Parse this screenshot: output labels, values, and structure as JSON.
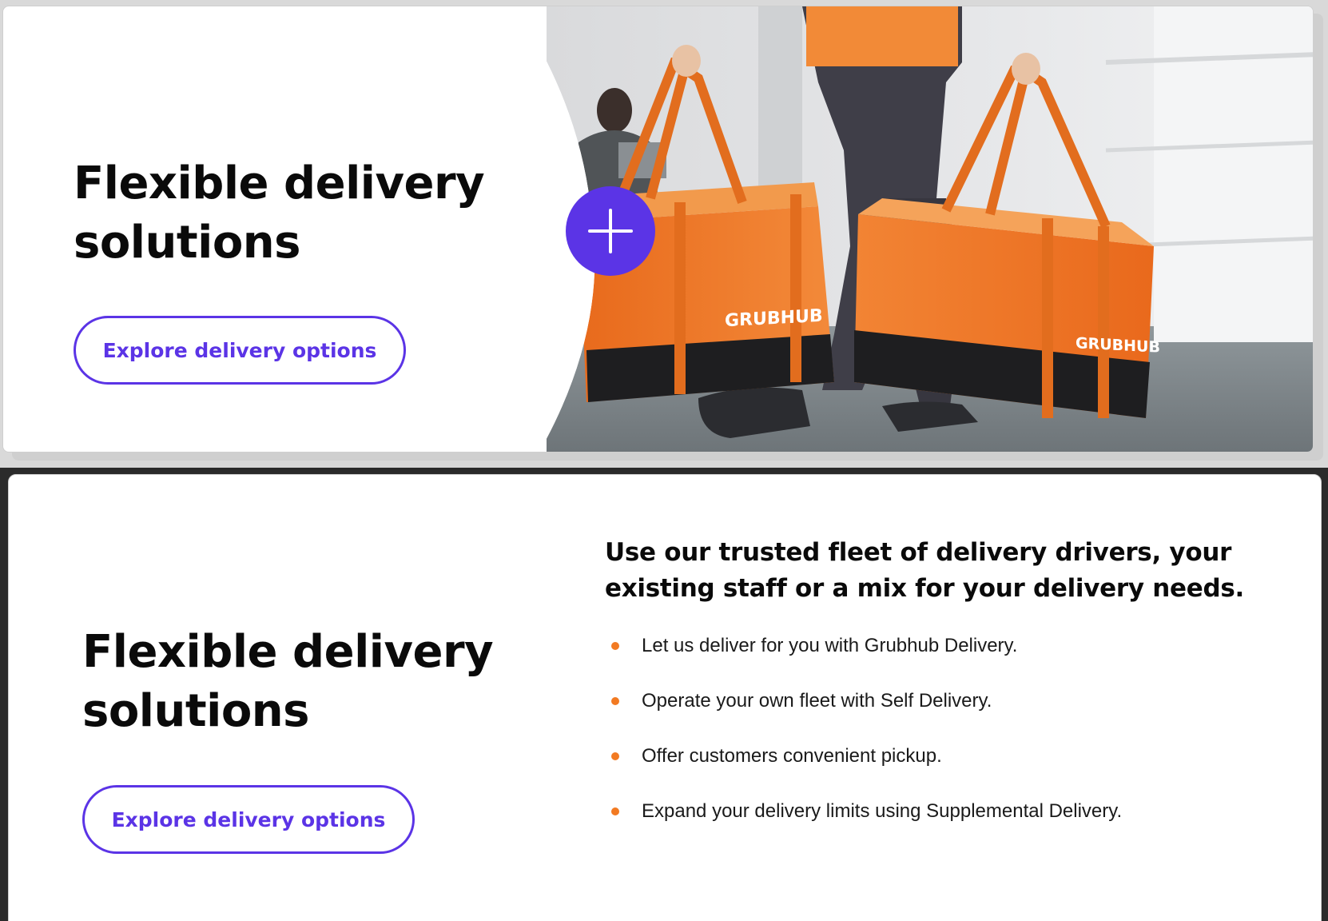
{
  "top_card": {
    "headline_line1": "Flexible delivery",
    "headline_line2": "solutions",
    "cta_label": "Explore delivery options",
    "bag_brand_left": "GRUBHUB",
    "bag_brand_right": "GRUBHUB",
    "expand_icon": "plus-icon"
  },
  "bottom_card": {
    "headline_line1": "Flexible delivery",
    "headline_line2": "solutions",
    "cta_label": "Explore delivery options",
    "details_title": "Use our trusted fleet of delivery drivers, your existing staff or a mix for your delivery needs.",
    "bullets": [
      "Let us deliver for you with Grubhub Delivery.",
      "Operate your own fleet with Self Delivery.",
      "Offer customers convenient pickup.",
      "Expand your delivery limits using Supplemental Delivery."
    ]
  },
  "colors": {
    "accent": "#5b34e6",
    "bullet": "#f27a22",
    "bag_orange": "#f07a2a"
  }
}
